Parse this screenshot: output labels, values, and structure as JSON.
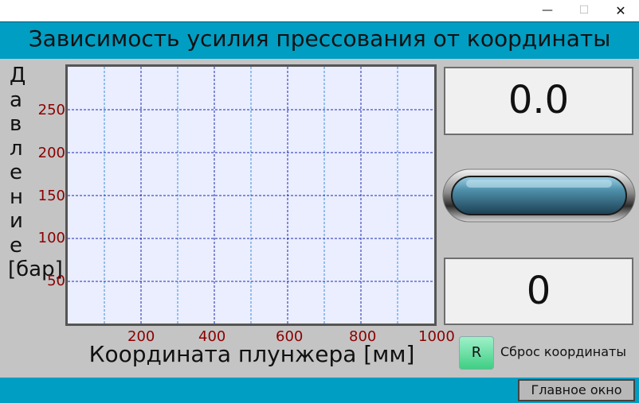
{
  "window": {
    "minimize": "—",
    "maximize": "☐",
    "close": "✕"
  },
  "header": {
    "title": "Зависимость усилия прессования от координаты"
  },
  "chart_data": {
    "type": "line",
    "ylabel_letters": [
      "Д",
      "а",
      "в",
      "л",
      "е",
      "н",
      "и",
      "е",
      "[бар]"
    ],
    "xlabel": "Координата плунжера [мм]",
    "y_ticks": [
      "250",
      "200",
      "150",
      "100",
      "50"
    ],
    "x_ticks": [
      "200",
      "400",
      "600",
      "800",
      "1000"
    ],
    "xlim": [
      0,
      1000
    ],
    "ylim": [
      0,
      300
    ],
    "grid": true,
    "series": []
  },
  "displays": {
    "pressure_value": "0.0",
    "coordinate_value": "0"
  },
  "reset": {
    "button_label": "R",
    "label": "Сброс координаты"
  },
  "footer": {
    "main_window_button": "Главное окно"
  },
  "colors": {
    "header": "#009ec3",
    "tick_label": "#8b0000",
    "plot_bg": "#ebeeff",
    "grid": "#1a2ab0"
  }
}
